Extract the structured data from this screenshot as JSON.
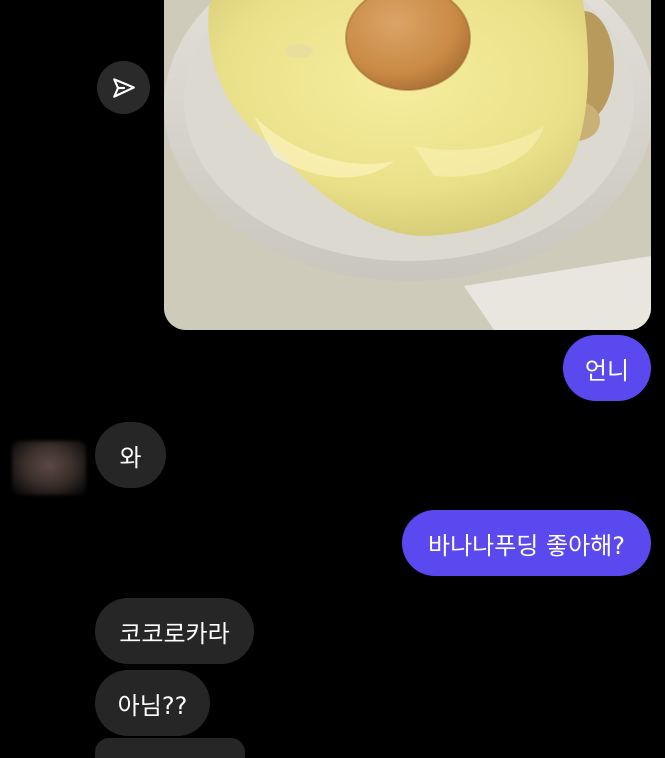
{
  "chat": {
    "image_alt": "",
    "messages": [
      {
        "id": "m1",
        "side": "sent",
        "text": "언니"
      },
      {
        "id": "m2",
        "side": "received",
        "text": "와"
      },
      {
        "id": "m3",
        "side": "sent",
        "text": "바나나푸딩 좋아해?"
      },
      {
        "id": "m4",
        "side": "received",
        "text": "코코로카라"
      },
      {
        "id": "m5",
        "side": "received",
        "text": "아님??"
      }
    ]
  },
  "colors": {
    "background": "#000000",
    "sent_bubble": "#5b49f0",
    "received_bubble": "#262626",
    "share_button": "#2a2a2a"
  },
  "icons": {
    "share": "paper-plane-icon"
  }
}
